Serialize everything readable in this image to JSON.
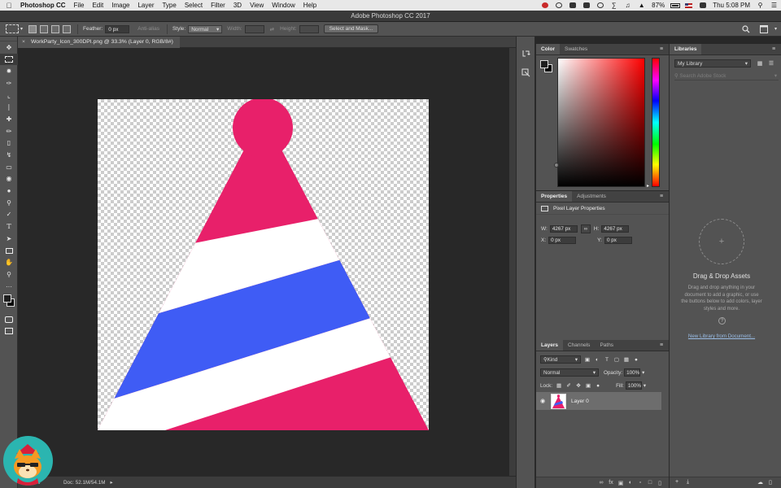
{
  "menubar": {
    "app_name": "Photoshop CC",
    "items": [
      "File",
      "Edit",
      "Image",
      "Layer",
      "Type",
      "Select",
      "Filter",
      "3D",
      "View",
      "Window",
      "Help"
    ],
    "battery": "87%",
    "clock": "Thu 5:08 PM"
  },
  "window": {
    "title": "Adobe Photoshop CC 2017"
  },
  "options": {
    "feather_label": "Feather:",
    "feather_value": "0 px",
    "antialias_label": "Anti-alias",
    "style_label": "Style:",
    "style_value": "Normal",
    "width_label": "Width:",
    "height_label": "Height:",
    "select_mask_button": "Select and Mask..."
  },
  "document": {
    "tab_title": "WorkParty_Icon_300DPI.png @ 33.3% (Layer 0, RGB/8#)",
    "zoom": "33.33%",
    "doc_info": "Doc: 52.1M/54.1M"
  },
  "artwork": {
    "colors": {
      "pink": "#e8206a",
      "white": "#ffffff",
      "blue": "#3f5cf5"
    }
  },
  "color_panel": {
    "tabs": [
      "Color",
      "Swatches"
    ],
    "foreground": "#1e1e1e",
    "background": "#000000"
  },
  "properties_panel": {
    "tabs": [
      "Properties",
      "Adjustments"
    ],
    "heading": "Pixel Layer Properties",
    "w_label": "W:",
    "w_value": "4267 px",
    "h_label": "H:",
    "h_value": "4267 px",
    "x_label": "X:",
    "x_value": "0 px",
    "y_label": "Y:",
    "y_value": "0 px"
  },
  "layers_panel": {
    "tabs": [
      "Layers",
      "Channels",
      "Paths"
    ],
    "filter_value": "Kind",
    "blend_mode": "Normal",
    "opacity_label": "Opacity:",
    "opacity_value": "100%",
    "lock_label": "Lock:",
    "fill_label": "Fill:",
    "fill_value": "100%",
    "layer_name": "Layer 0"
  },
  "libraries_panel": {
    "tab": "Libraries",
    "library_name": "My Library",
    "search_placeholder": "Search Adobe Stock",
    "drop_title": "Drag & Drop Assets",
    "drop_description": "Drag and drop anything in your document to add a graphic, or use the buttons below to add colors, layer styles and more.",
    "new_library_link": "New Library from Document..."
  }
}
